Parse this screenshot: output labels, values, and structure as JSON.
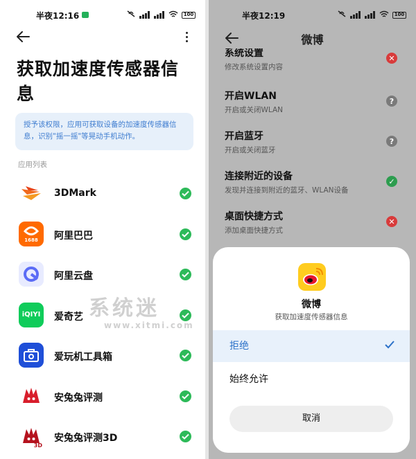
{
  "left": {
    "status_time": "半夜12:16",
    "battery": "100",
    "title": "获取加速度传感器信息",
    "info": "授予该权限，应用可获取设备的加速度传感器信息，识别\"摇一摇\"等晃动手机动作。",
    "section_label": "应用列表",
    "apps": [
      {
        "name": "3DMark",
        "icon": "3dmark-icon"
      },
      {
        "name": "阿里巴巴",
        "icon": "alibaba-icon"
      },
      {
        "name": "阿里云盘",
        "icon": "aliyun-drive-icon"
      },
      {
        "name": "爱奇艺",
        "icon": "iqiyi-icon"
      },
      {
        "name": "爱玩机工具箱",
        "icon": "toolbox-icon"
      },
      {
        "name": "安兔兔评测",
        "icon": "antutu-icon"
      },
      {
        "name": "安兔兔评测3D",
        "icon": "antutu3d-icon"
      }
    ],
    "iqiyi_text": "iQIYI",
    "alibaba_badge": "1688",
    "antutu3d_badge": "3D"
  },
  "right": {
    "status_time": "半夜12:19",
    "battery": "100",
    "title": "微博",
    "permissions": [
      {
        "title": "系统设置",
        "desc": "修改系统设置内容",
        "status": "denied"
      },
      {
        "title": "开启WLAN",
        "desc": "开启或关闭WLAN",
        "status": "ask"
      },
      {
        "title": "开启蓝牙",
        "desc": "开启或关闭蓝牙",
        "status": "ask"
      },
      {
        "title": "连接附近的设备",
        "desc": "发现并连接到附近的蓝牙、WLAN设备",
        "status": "allowed"
      },
      {
        "title": "桌面快捷方式",
        "desc": "添加桌面快捷方式",
        "status": "denied"
      }
    ],
    "dialog": {
      "app_name": "微博",
      "desc": "获取加速度传感器信息",
      "options": [
        "拒绝",
        "始终允许"
      ],
      "selected": "拒绝",
      "cancel": "取消"
    }
  },
  "watermark": {
    "main": "系统迷",
    "sub": "www.xitmi.com"
  },
  "colors": {
    "accent": "#2b71c8",
    "allowed": "#2dba59",
    "denied": "#d83b3b",
    "ask": "#7a7a7a",
    "info_bg": "#e7f0fa"
  }
}
